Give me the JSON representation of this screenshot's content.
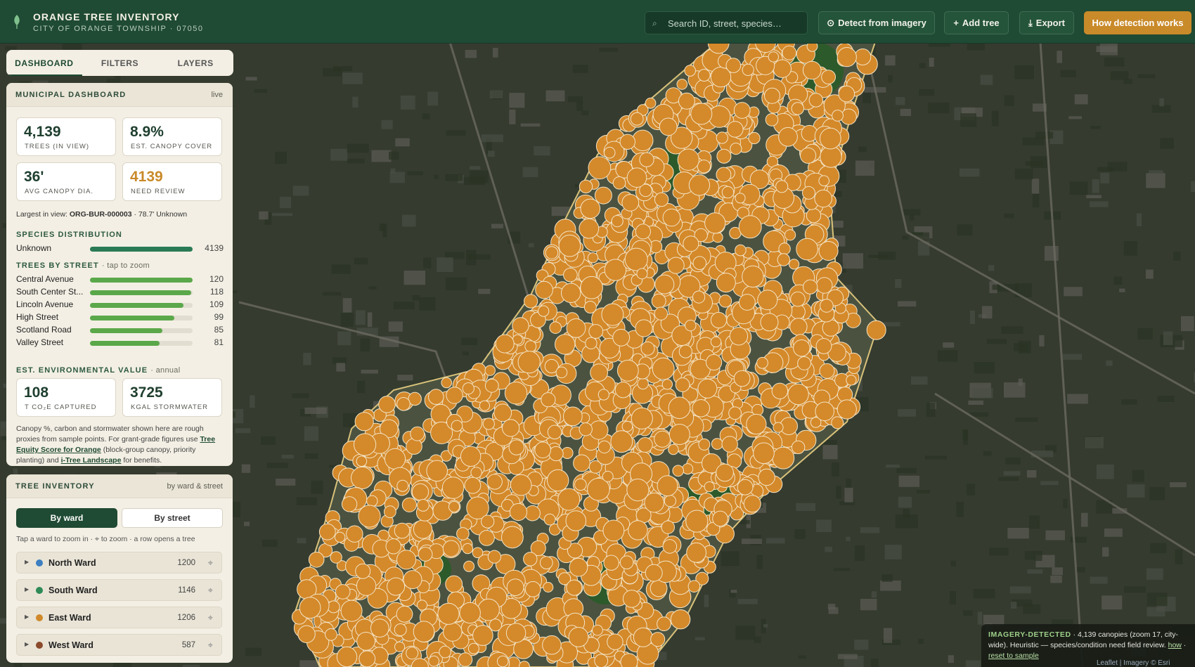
{
  "header": {
    "title": "ORANGE TREE INVENTORY",
    "subtitle": "CITY OF ORANGE TOWNSHIP · 07050",
    "search_placeholder": "Search ID, street, species…",
    "detect_label": "Detect from imagery",
    "add_label": "Add tree",
    "export_label": "Export",
    "how_label": "How detection works"
  },
  "tabs": [
    "DASHBOARD",
    "FILTERS",
    "LAYERS"
  ],
  "dashboard": {
    "title": "MUNICIPAL DASHBOARD",
    "status": "live",
    "kpis": [
      {
        "value": "4,139",
        "label": "TREES (IN VIEW)"
      },
      {
        "value": "8.9%",
        "label": "EST. CANOPY COVER"
      },
      {
        "value": "36'",
        "label": "AVG CANOPY DIA."
      },
      {
        "value": "4139",
        "label": "NEED REVIEW"
      }
    ],
    "largest_prefix": "Largest in view:",
    "largest_id": "ORG-BUR-000003",
    "largest_suffix": "· 78.7' Unknown",
    "species_title": "SPECIES DISTRIBUTION",
    "species": [
      {
        "name": "Unknown",
        "count": 4139,
        "fraction": 1.0
      }
    ],
    "streets_title": "TREES BY STREET",
    "streets_note": "· tap to zoom",
    "streets": [
      {
        "name": "Central Avenue",
        "count": 120
      },
      {
        "name": "South Center St...",
        "count": 118
      },
      {
        "name": "Lincoln Avenue",
        "count": 109
      },
      {
        "name": "High Street",
        "count": 99
      },
      {
        "name": "Scotland Road",
        "count": 85
      },
      {
        "name": "Valley Street",
        "count": 81
      }
    ],
    "env_title": "EST. ENVIRONMENTAL VALUE",
    "env_note": "· annual",
    "env": [
      {
        "value": "108",
        "label": "T CO₂E CAPTURED"
      },
      {
        "value": "3725",
        "label": "KGAL STORMWATER"
      }
    ],
    "note_text_1": "Canopy %, carbon and stormwater shown here are rough proxies from sample points. For grant-grade figures use ",
    "note_link_1": "Tree Equity Score for Orange",
    "note_text_2": " (block-group canopy, priority planting) and ",
    "note_link_2": "i-Tree Landscape",
    "note_text_3": " for benefits."
  },
  "inventory": {
    "title": "TREE INVENTORY",
    "right": "by ward & street",
    "seg_on": "By ward",
    "seg_off": "By street",
    "hint": "Tap a ward to zoom in · ⌖ to zoom · a row opens a tree",
    "wards": [
      {
        "name": "North Ward",
        "count": "1200",
        "color": "#3d7fc1"
      },
      {
        "name": "South Ward",
        "count": "1146",
        "color": "#2e8b57"
      },
      {
        "name": "East Ward",
        "count": "1206",
        "color": "#d0892a"
      },
      {
        "name": "West Ward",
        "count": "587",
        "color": "#8b4a2b"
      }
    ]
  },
  "attribution": {
    "tag": "IMAGERY-DETECTED",
    "text": " · 4,139 canopies (zoom 17, city-wide). Heuristic — species/condition need field review. ",
    "how": "how",
    "sep": " · ",
    "reset": "reset to sample",
    "leaflet": "Leaflet | Imagery © Esri"
  },
  "colors": {
    "header": "#1f4a33",
    "accent": "#c98a2a",
    "tree_marker": "#d4892a",
    "bar": "#5ba84a"
  }
}
